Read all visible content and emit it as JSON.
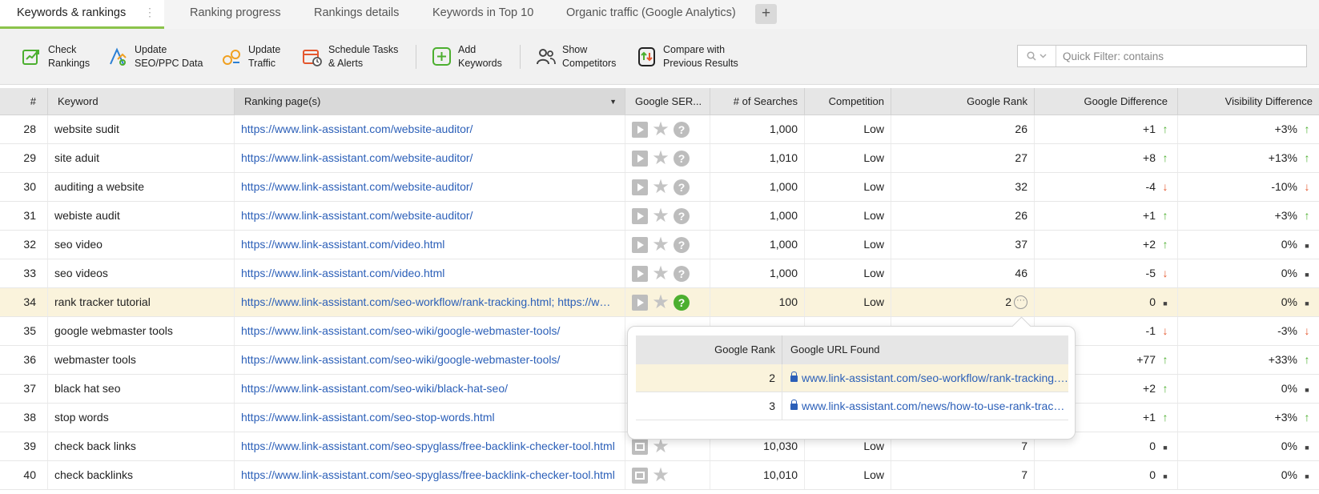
{
  "tabs": [
    {
      "label": "Keywords & rankings",
      "active": true
    },
    {
      "label": "Ranking progress"
    },
    {
      "label": "Rankings details"
    },
    {
      "label": "Keywords in Top 10"
    },
    {
      "label": "Organic traffic (Google Analytics)"
    }
  ],
  "tab_menu_glyph": "⋮",
  "tab_add_glyph": "+",
  "toolbar": {
    "check_rankings": "Check\nRankings",
    "update_seo_ppc": "Update\nSEO/PPC Data",
    "update_traffic": "Update\nTraffic",
    "schedule_tasks": "Schedule Tasks\n& Alerts",
    "add_keywords": "Add\nKeywords",
    "show_competitors": "Show\nCompetitors",
    "compare_results": "Compare with\nPrevious Results",
    "quick_filter_placeholder": "Quick Filter: contains"
  },
  "columns": {
    "num": "#",
    "keyword": "Keyword",
    "ranking_page": "Ranking page(s)",
    "google_serp": "Google SER...",
    "searches": "# of Searches",
    "competition": "Competition",
    "google_rank": "Google Rank",
    "google_diff": "Google Difference",
    "visibility_diff": "Visibility Difference"
  },
  "rows": [
    {
      "num": "28",
      "keyword": "website sudit",
      "url": "https://www.link-assistant.com/website-auditor/",
      "serp": [
        "video",
        "star",
        "question"
      ],
      "searches": "1,000",
      "competition": "Low",
      "rank": "26",
      "gdiff": "+1",
      "gdir": "up",
      "vdiff": "+3%",
      "vdir": "up"
    },
    {
      "num": "29",
      "keyword": "site aduit",
      "url": "https://www.link-assistant.com/website-auditor/",
      "serp": [
        "video",
        "star",
        "question"
      ],
      "searches": "1,010",
      "competition": "Low",
      "rank": "27",
      "gdiff": "+8",
      "gdir": "up",
      "vdiff": "+13%",
      "vdir": "up"
    },
    {
      "num": "30",
      "keyword": "auditing a website",
      "url": "https://www.link-assistant.com/website-auditor/",
      "serp": [
        "video",
        "star",
        "question"
      ],
      "searches": "1,000",
      "competition": "Low",
      "rank": "32",
      "gdiff": "-4",
      "gdir": "down",
      "vdiff": "-10%",
      "vdir": "down"
    },
    {
      "num": "31",
      "keyword": "webiste audit",
      "url": "https://www.link-assistant.com/website-auditor/",
      "serp": [
        "video",
        "star",
        "question"
      ],
      "searches": "1,000",
      "competition": "Low",
      "rank": "26",
      "gdiff": "+1",
      "gdir": "up",
      "vdiff": "+3%",
      "vdir": "up"
    },
    {
      "num": "32",
      "keyword": "seo video",
      "url": "https://www.link-assistant.com/video.html",
      "serp": [
        "video",
        "star",
        "question"
      ],
      "searches": "1,000",
      "competition": "Low",
      "rank": "37",
      "gdiff": "+2",
      "gdir": "up",
      "vdiff": "0%",
      "vdir": "none"
    },
    {
      "num": "33",
      "keyword": "seo videos",
      "url": "https://www.link-assistant.com/video.html",
      "serp": [
        "video",
        "star",
        "question"
      ],
      "searches": "1,000",
      "competition": "Low",
      "rank": "46",
      "gdiff": "-5",
      "gdir": "down",
      "vdiff": "0%",
      "vdir": "none"
    },
    {
      "num": "34",
      "keyword": "rank tracker tutorial",
      "url": "https://www.link-assistant.com/seo-workflow/rank-tracking.html; https://www.link-assistant.com/news/how-to-use-rank-tracker.html",
      "serp": [
        "video",
        "star",
        "question-green"
      ],
      "searches": "100",
      "competition": "Low",
      "rank": "2",
      "rank_more": true,
      "gdiff": "0",
      "gdir": "none",
      "vdiff": "0%",
      "vdir": "none",
      "highlight": true
    },
    {
      "num": "35",
      "keyword": "google webmaster tools",
      "url": "https://www.link-assistant.com/seo-wiki/google-webmaster-tools/",
      "serp": [],
      "searches": "",
      "competition": "",
      "rank": "",
      "gdiff": "-1",
      "gdir": "down",
      "vdiff": "-3%",
      "vdir": "down"
    },
    {
      "num": "36",
      "keyword": "webmaster tools",
      "url": "https://www.link-assistant.com/seo-wiki/google-webmaster-tools/",
      "serp": [],
      "searches": "",
      "competition": "",
      "rank": "",
      "gdiff": "+77",
      "gdir": "up",
      "vdiff": "+33%",
      "vdir": "up"
    },
    {
      "num": "37",
      "keyword": "black hat seo",
      "url": "https://www.link-assistant.com/seo-wiki/black-hat-seo/",
      "serp": [],
      "searches": "",
      "competition": "",
      "rank": "",
      "gdiff": "+2",
      "gdir": "up",
      "vdiff": "0%",
      "vdir": "none"
    },
    {
      "num": "38",
      "keyword": "stop words",
      "url": "https://www.link-assistant.com/seo-stop-words.html",
      "serp": [],
      "searches": "",
      "competition": "",
      "rank": "",
      "gdiff": "+1",
      "gdir": "up",
      "vdiff": "+3%",
      "vdir": "up"
    },
    {
      "num": "39",
      "keyword": "check back links",
      "url": "https://www.link-assistant.com/seo-spyglass/free-backlink-checker-tool.html",
      "serp": [
        "image",
        "star"
      ],
      "searches": "10,030",
      "competition": "Low",
      "rank": "7",
      "gdiff": "0",
      "gdir": "none",
      "vdiff": "0%",
      "vdir": "none"
    },
    {
      "num": "40",
      "keyword": "check backlinks",
      "url": "https://www.link-assistant.com/seo-spyglass/free-backlink-checker-tool.html",
      "serp": [
        "image",
        "star"
      ],
      "searches": "10,010",
      "competition": "Low",
      "rank": "7",
      "gdiff": "0",
      "gdir": "none",
      "vdiff": "0%",
      "vdir": "none"
    }
  ],
  "popover": {
    "col_rank": "Google Rank",
    "col_url": "Google URL Found",
    "rows": [
      {
        "rank": "2",
        "url": "www.link-assistant.com/seo-workflow/rank-tracking.html",
        "highlight": true
      },
      {
        "rank": "3",
        "url": "www.link-assistant.com/news/how-to-use-rank-tracker.html"
      }
    ]
  },
  "colors": {
    "accent_green": "#8bc34a",
    "link_blue": "#2b5fb8",
    "up_green": "#4caf2f",
    "down_red": "#e4572e",
    "highlight_row": "#faf3dc"
  }
}
